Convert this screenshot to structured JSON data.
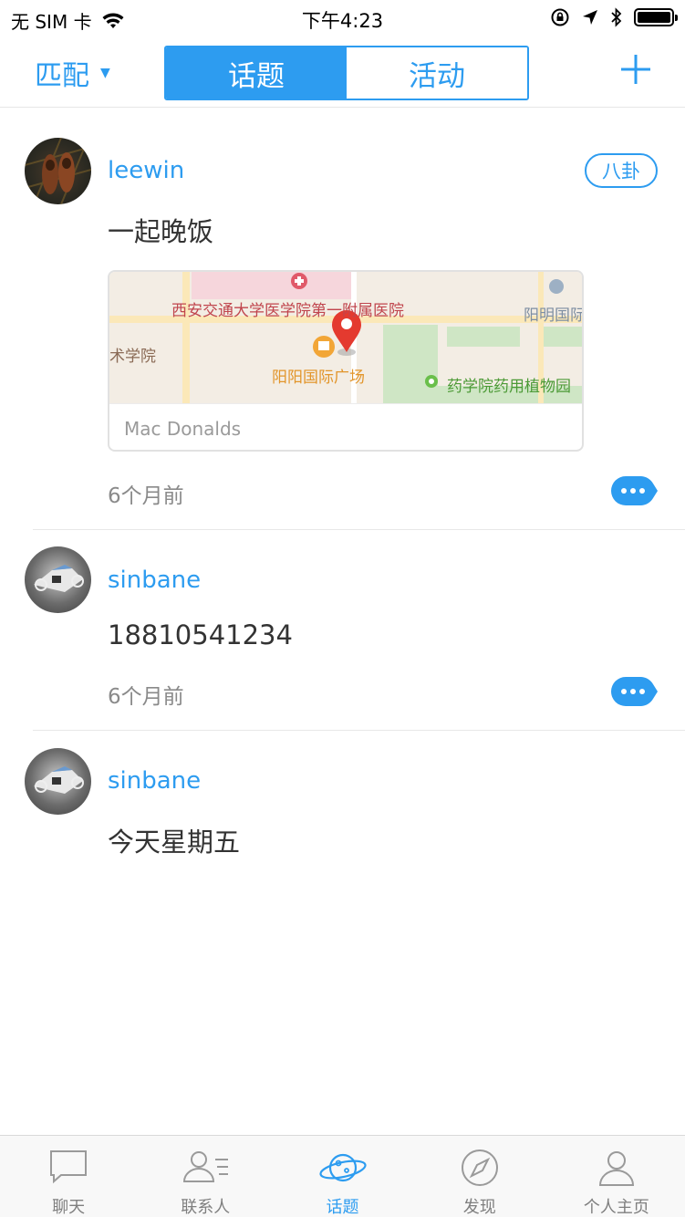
{
  "status_bar": {
    "carrier": "无 SIM 卡",
    "time": "下午4:23"
  },
  "nav": {
    "filter_label": "匹配",
    "segments": [
      {
        "label": "话题",
        "active": true
      },
      {
        "label": "活动",
        "active": false
      }
    ],
    "add_icon": "plus-icon",
    "accent": "#2d9cf0"
  },
  "posts": [
    {
      "username": "leewin",
      "tag": "八卦",
      "content": "一起晚饭",
      "location": {
        "name": "Mac Donalds",
        "map_labels": {
          "hospital": "西安交通大学医学院第一附属医院",
          "plaza": "阳阳国际广场",
          "garden": "药学院药用植物园",
          "art_school": "术学院",
          "right": "阳明国际"
        }
      },
      "time": "6个月前"
    },
    {
      "username": "sinbane",
      "content": "18810541234",
      "time": "6个月前"
    },
    {
      "username": "sinbane",
      "content": "今天星期五"
    }
  ],
  "tab_bar": [
    {
      "label": "聊天",
      "icon": "chat-icon",
      "active": false
    },
    {
      "label": "联系人",
      "icon": "contacts-icon",
      "active": false
    },
    {
      "label": "话题",
      "icon": "planet-icon",
      "active": true
    },
    {
      "label": "发现",
      "icon": "compass-icon",
      "active": false
    },
    {
      "label": "个人主页",
      "icon": "person-icon",
      "active": false
    }
  ]
}
